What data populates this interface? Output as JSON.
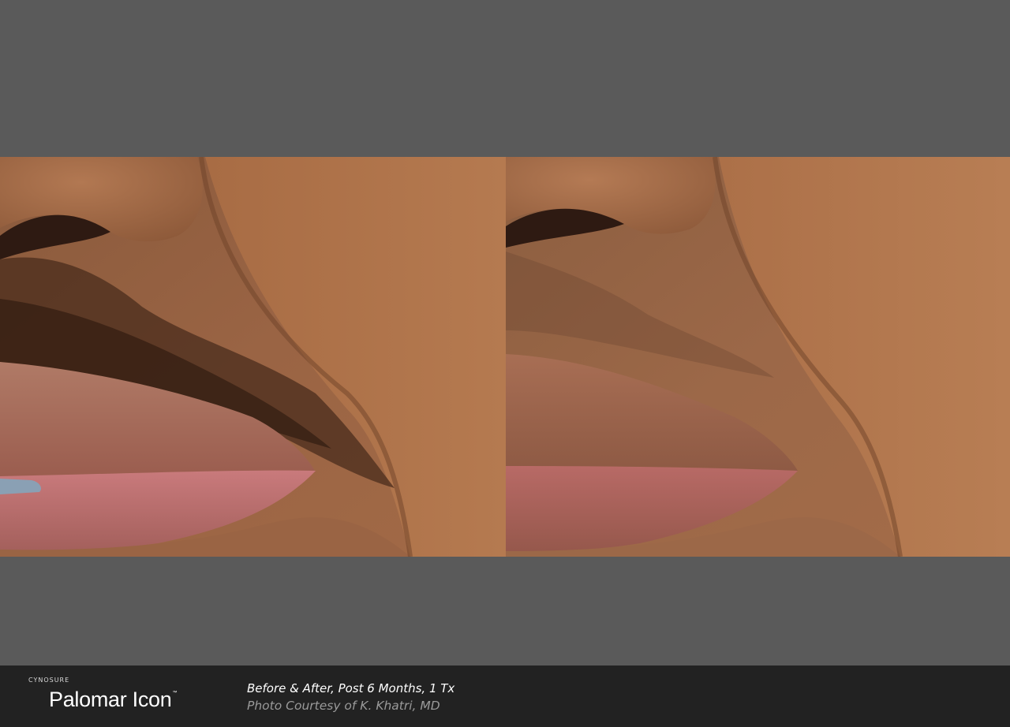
{
  "photos": [
    {
      "id": "before",
      "description": "close-up of upper lip with dark hair"
    },
    {
      "id": "after",
      "description": "close-up of upper lip after treatment"
    }
  ],
  "footer": {
    "brand_small": "CYNOSURE",
    "brand_main": "Palomar Icon",
    "brand_tm": "™",
    "caption_line1": "Before & After, Post 6 Months, 1 Tx",
    "caption_line2": "Photo Courtesy of K. Khatri, MD"
  },
  "colors": {
    "background": "#5a5a5a",
    "footer": "#222222",
    "caption_primary": "#ffffff",
    "caption_secondary": "#9a9a9a"
  }
}
